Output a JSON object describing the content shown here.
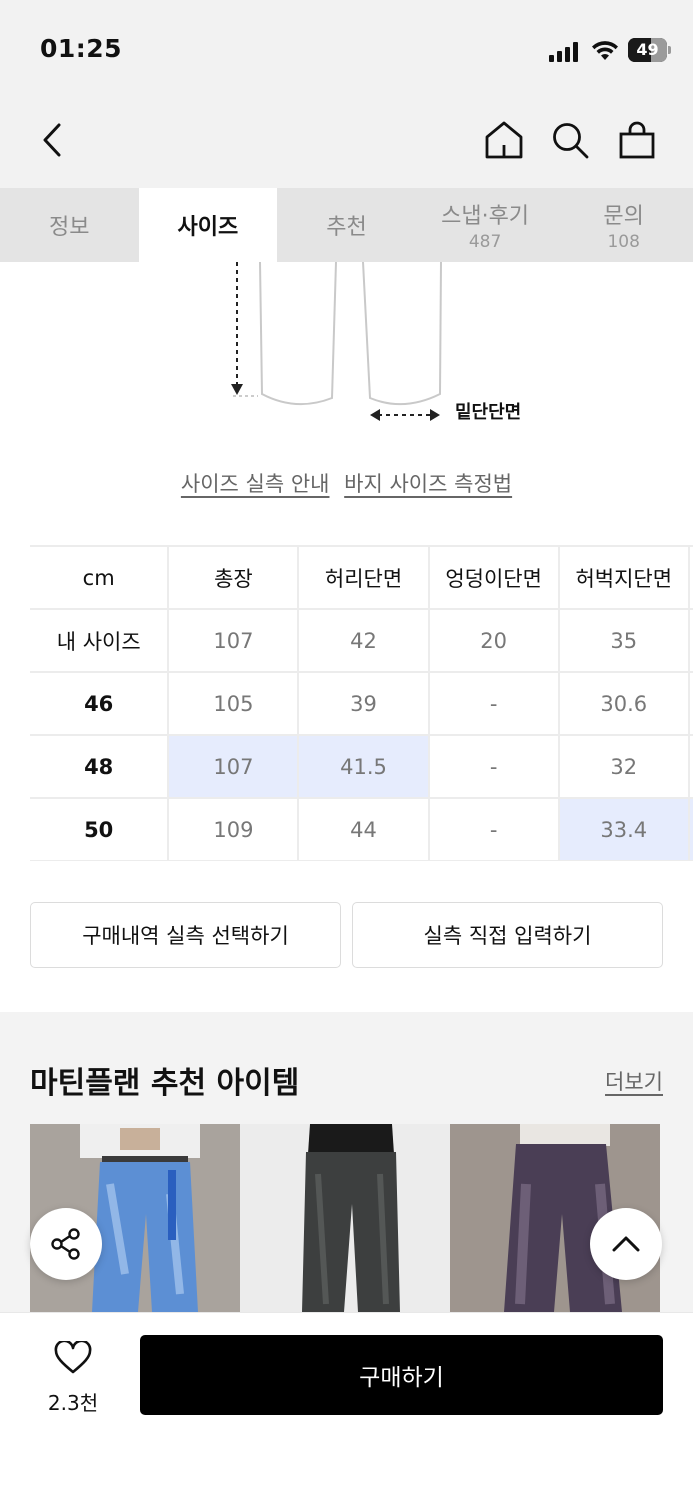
{
  "status_bar": {
    "time": "01:25",
    "battery": "49"
  },
  "nav": {
    "back_icon": "chevron-left-icon",
    "home_icon": "home-icon",
    "search_icon": "search-icon",
    "cart_icon": "shopping-bag-icon"
  },
  "tabs": [
    {
      "label": "정보",
      "count": ""
    },
    {
      "label": "사이즈",
      "count": "",
      "active": true
    },
    {
      "label": "추천",
      "count": ""
    },
    {
      "label": "스냅·후기",
      "count": "487"
    },
    {
      "label": "문의",
      "count": "108"
    }
  ],
  "diagram": {
    "hem_label": "밑단단면"
  },
  "guide_links": {
    "actual_size_guide": "사이즈 실측 안내",
    "pants_measure_guide": "바지 사이즈 측정법"
  },
  "size_table": {
    "unit_header": "cm",
    "headers": [
      "총장",
      "허리단면",
      "엉덩이단면",
      "허벅지단면"
    ],
    "rows": [
      {
        "label": "내 사이즈",
        "values": [
          "107",
          "42",
          "20",
          "35"
        ]
      },
      {
        "label": "46",
        "values": [
          "105",
          "39",
          "-",
          "30.6"
        ]
      },
      {
        "label": "48",
        "values": [
          "107",
          "41.5",
          "-",
          "32"
        ]
      },
      {
        "label": "50",
        "values": [
          "109",
          "44",
          "-",
          "33.4"
        ]
      }
    ],
    "highlight_color": "#e6ecfd"
  },
  "actions": {
    "select_from_purchases": "구매내역 실측 선택하기",
    "enter_directly": "실측 직접 입력하기"
  },
  "recommend": {
    "title": "마틴플랜 추천 아이템",
    "more": "더보기"
  },
  "bottom_bar": {
    "like_count": "2.3천",
    "buy_label": "구매하기"
  }
}
